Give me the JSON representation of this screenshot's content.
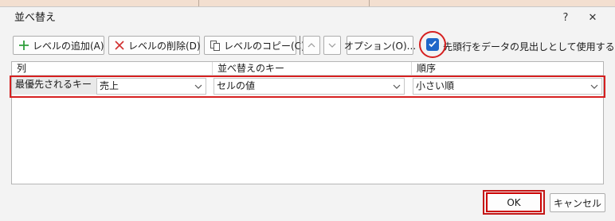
{
  "window": {
    "title": "並べ替え",
    "help_label": "?",
    "close_label": "✕"
  },
  "toolbar": {
    "add_level": "レベルの追加(A)",
    "delete_level": "レベルの削除(D)",
    "copy_level": "レベルのコピー(C)",
    "options": "オプション(O)...",
    "header_checkbox_label": "先頭行をデータの見出しとして使用する(H)",
    "header_checkbox_checked": true
  },
  "grid": {
    "headers": {
      "column": "列",
      "sort_on": "並べ替えのキー",
      "order": "順序"
    },
    "rows": [
      {
        "label": "最優先されるキー",
        "column": "売上",
        "sort_on": "セルの値",
        "order": "小さい順"
      }
    ]
  },
  "buttons": {
    "ok": "OK",
    "cancel": "キャンセル"
  },
  "colors": {
    "accent": "#1f66c8",
    "annotation_red": "#d62020",
    "dialog_bg": "#f3f3f3",
    "add_icon": "#2e9e3a",
    "delete_icon": "#d12f2f"
  },
  "icons": {
    "add": "plus-icon",
    "delete": "x-icon",
    "copy": "copy-icon",
    "move_up": "chevron-up-icon",
    "move_down": "chevron-down-icon",
    "dropdown": "chevron-down-icon",
    "checkbox": "checkmark-icon"
  }
}
